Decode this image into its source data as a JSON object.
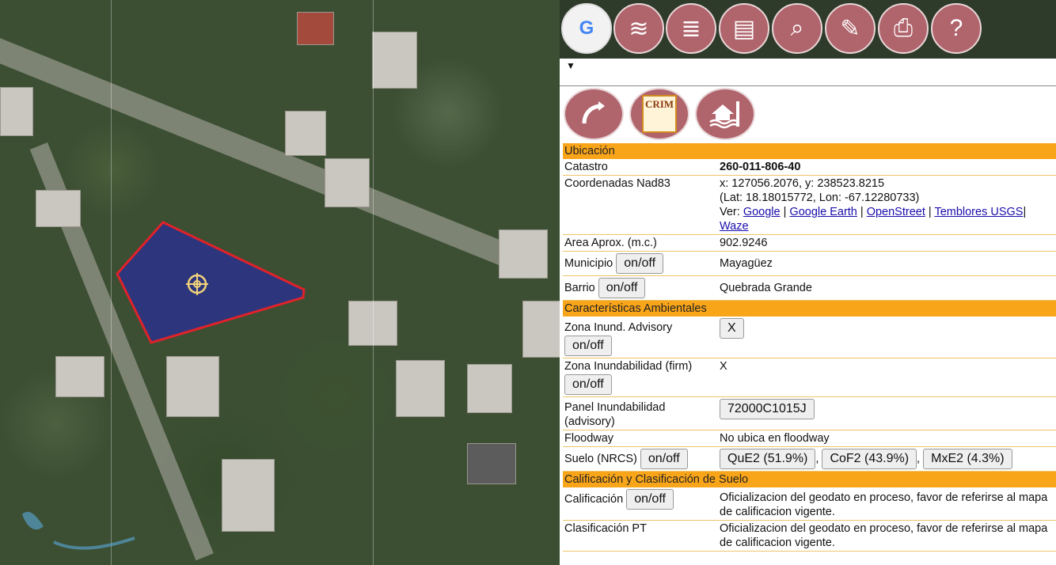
{
  "map": {
    "watermark": "logo"
  },
  "toolbar": {
    "buttons": [
      {
        "icon": "google-maps-icon",
        "glyph": "G"
      },
      {
        "icon": "layers-icon",
        "glyph": "≋"
      },
      {
        "icon": "layers-stack-icon",
        "glyph": "≣"
      },
      {
        "icon": "document-icon",
        "glyph": "▤"
      },
      {
        "icon": "search-icon",
        "glyph": "⌕"
      },
      {
        "icon": "edit-icon",
        "glyph": "✎"
      },
      {
        "icon": "print-icon",
        "glyph": "⎙"
      },
      {
        "icon": "help-icon",
        "glyph": "?"
      }
    ]
  },
  "panel": {
    "caret": "▼",
    "crim_logo": "CRIM",
    "sections": {
      "ubicacion": "Ubicación",
      "ambientales": "Características Ambientales",
      "calificacion": "Calificación y Clasificación de Suelo"
    },
    "rows": {
      "catastro_label": "Catastro",
      "catastro_value": "260-011-806-40",
      "coord_label": "Coordenadas Nad83",
      "coord_xy": "x: 127056.2076, y: 238523.8215",
      "coord_latlon": "(Lat: 18.18015772, Lon: -67.12280733)",
      "ver_label": "Ver:",
      "links": [
        "Google",
        "Google Earth",
        "OpenStreet",
        "Temblores USGS",
        "Waze"
      ],
      "area_label": "Area Aprox. (m.c.)",
      "area_value": "902.9246",
      "municipio_label": "Municipio",
      "municipio_value": "Mayagüez",
      "barrio_label": "Barrio",
      "barrio_value": "Quebrada Grande",
      "onoff": "on/off",
      "zona_adv_label": "Zona Inund. Advisory",
      "zona_adv_value": "X",
      "zona_firm_label": "Zona Inundabilidad (firm)",
      "zona_firm_value": "X",
      "panel_label": "Panel Inundabilidad (advisory)",
      "panel_value": "72000C1015J",
      "floodway_label": "Floodway",
      "floodway_value": "No ubica en floodway",
      "suelo_label": "Suelo (NRCS)",
      "suelo_values": [
        "QuE2 (51.9%)",
        "CoF2 (43.9%)",
        "MxE2 (4.3%)"
      ],
      "calif_label": "Calificación",
      "calif_value": "Oficializacion del geodato en proceso, favor de referirse al mapa de calificacion vigente.",
      "clasif_label": "Clasificación PT",
      "clasif_value": "Oficializacion del geodato en proceso, favor de referirse al mapa de calificacion vigente."
    }
  }
}
